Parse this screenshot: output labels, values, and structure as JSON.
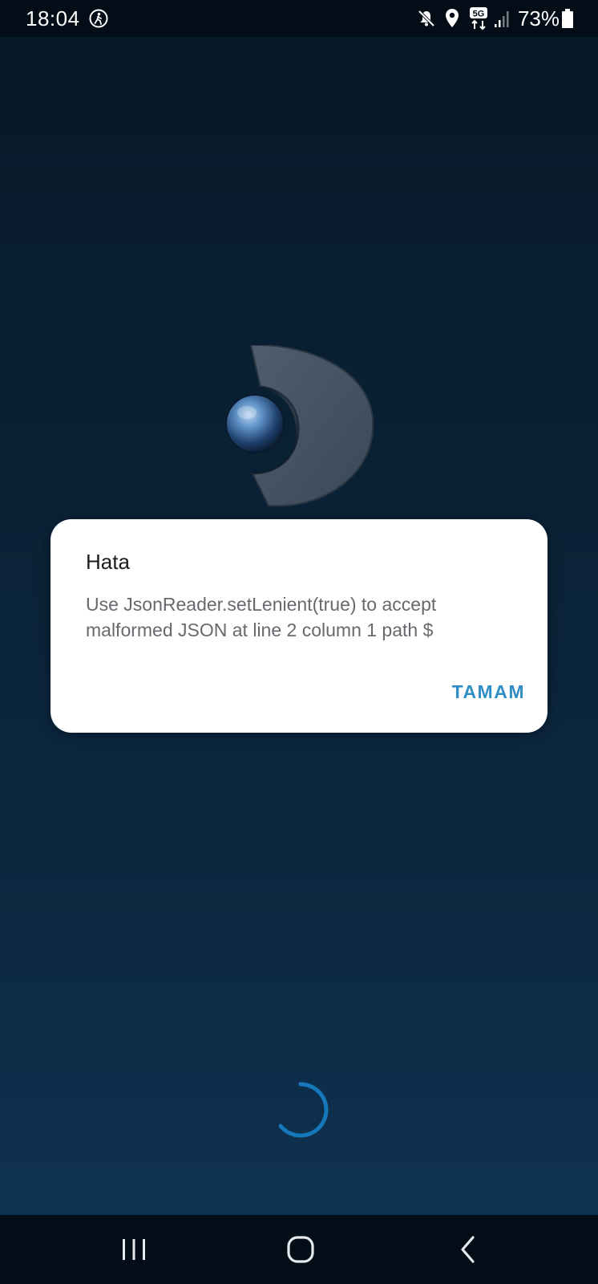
{
  "status_bar": {
    "time": "18:04",
    "network": "5G",
    "battery": "73%",
    "icons": [
      "accessibility-icon",
      "mute-icon",
      "location-icon",
      "5g-icon",
      "signal-icon",
      "battery-icon"
    ]
  },
  "dialog": {
    "title": "Hata",
    "message": "Use JsonReader.setLenient(true) to accept malformed JSON at line 2 column 1 path $",
    "ok_label": "TAMAM"
  },
  "nav": {
    "icons": [
      "recents-icon",
      "home-icon",
      "back-icon"
    ]
  },
  "colors": {
    "accent": "#2f8ec4",
    "spinner": "#1677bb",
    "background_top": "#061827",
    "background_bottom": "#0e3250",
    "bars": "#030d17"
  }
}
